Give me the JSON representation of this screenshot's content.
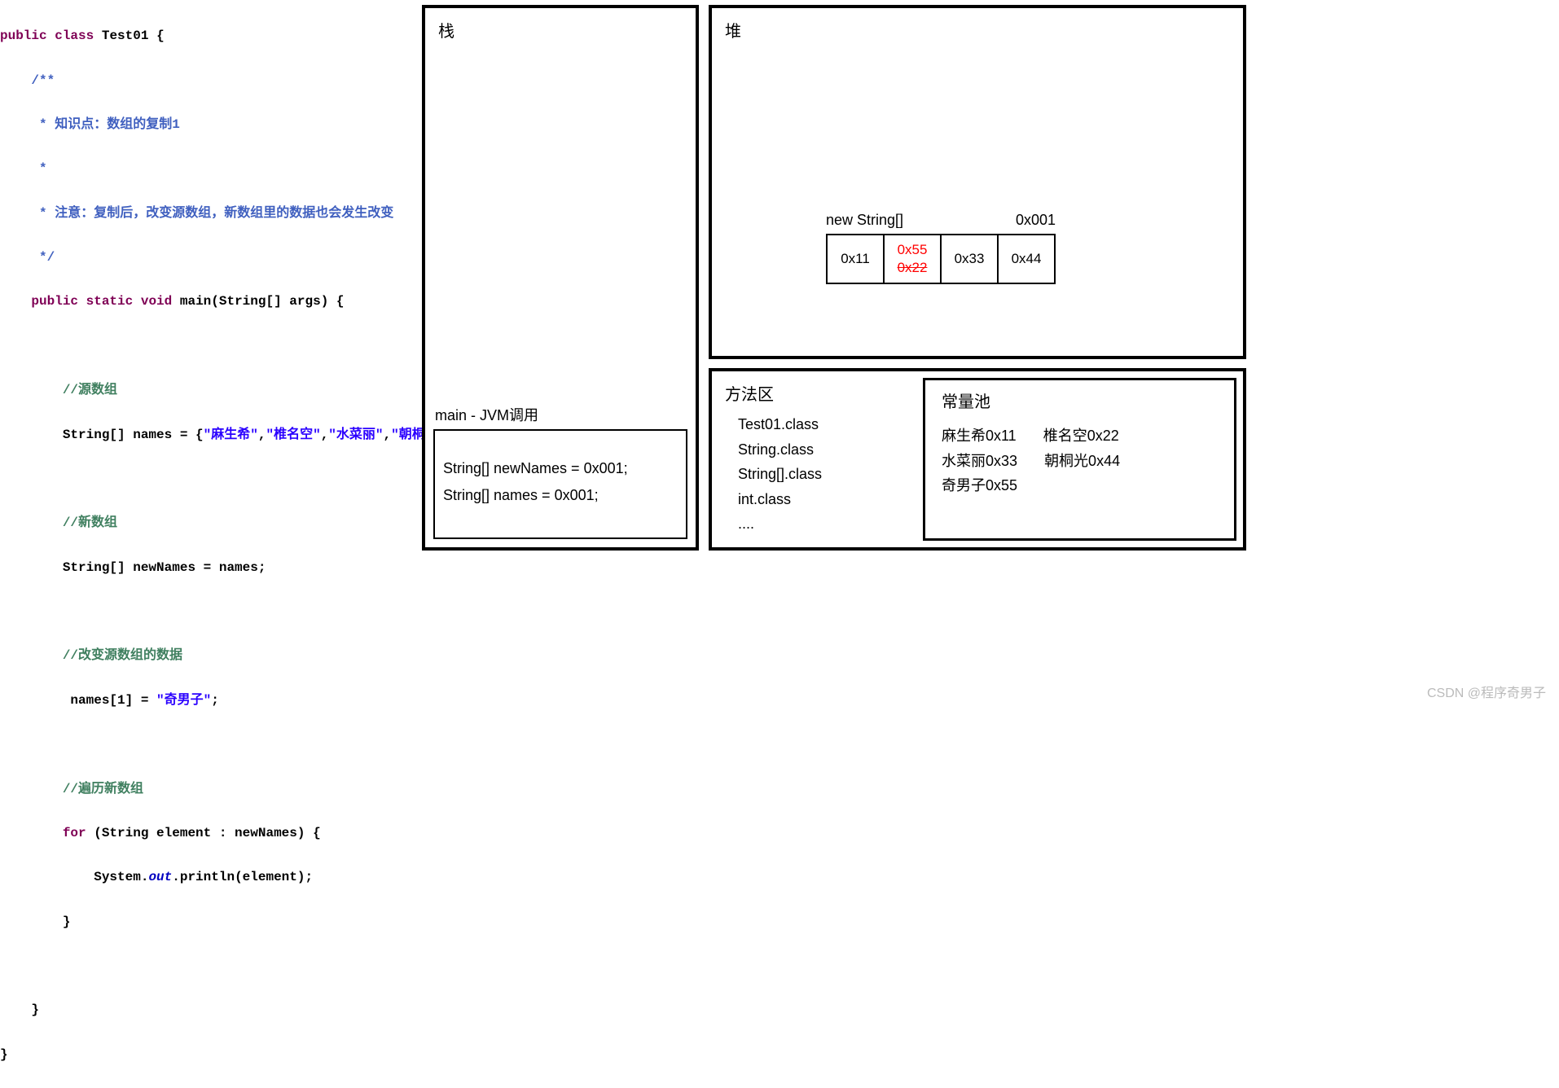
{
  "code": {
    "class_decl_kw1": "public",
    "class_decl_kw2": "class",
    "class_name": "Test01",
    "javadoc_open": "/**",
    "javadoc_l1": " * 知识点：数组的复制1",
    "javadoc_l2": " *",
    "javadoc_l3": " * 注意：复制后，改变源数组，新数组里的数据也会发生改变",
    "javadoc_close": " */",
    "main_kw_public": "public",
    "main_kw_static": "static",
    "main_kw_void": "void",
    "main_name": "main",
    "main_params": "(String[] args) {",
    "cmt_src": "//源数组",
    "decl_src_lhs": "String[] names = {",
    "str1": "\"麻生希\"",
    "str2": "\"椎名空\"",
    "str3": "\"水菜丽\"",
    "str4": "\"朝桐光\"",
    "decl_src_rhs": "};",
    "cmt_new": "//新数组",
    "decl_new": "String[] newNames = names;",
    "cmt_mod": "//改变源数组的数据",
    "stmt_mod_lhs": " names[1] = ",
    "stmt_mod_str": "\"奇男子\"",
    "stmt_mod_end": ";",
    "cmt_iter": "//遍历新数组",
    "for_kw": "for",
    "for_rest": " (String element : newNames) {",
    "println_sys": "System.",
    "println_out": "out",
    "println_call": ".println(element);",
    "brace_close": "}"
  },
  "stack": {
    "title": "栈",
    "main_label": "main - JVM调用",
    "line1": "String[] newNames = 0x001;",
    "line2": "String[] names = 0x001;"
  },
  "heap": {
    "title": "堆",
    "arr_label_left": "new String[]",
    "arr_label_right": "0x001",
    "cells": [
      "0x11",
      "0x33",
      "0x44"
    ],
    "mod_new": "0x55",
    "mod_old": "0x22"
  },
  "method_area": {
    "title": "方法区",
    "items": [
      "Test01.class",
      "String.class",
      "String[].class",
      "int.class",
      "...."
    ]
  },
  "const_pool": {
    "title": "常量池",
    "rows": [
      [
        "麻生希0x11",
        "椎名空0x22"
      ],
      [
        "水菜丽0x33",
        "朝桐光0x44"
      ],
      [
        "奇男子0x55"
      ]
    ]
  },
  "watermark": "CSDN @程序奇男子"
}
